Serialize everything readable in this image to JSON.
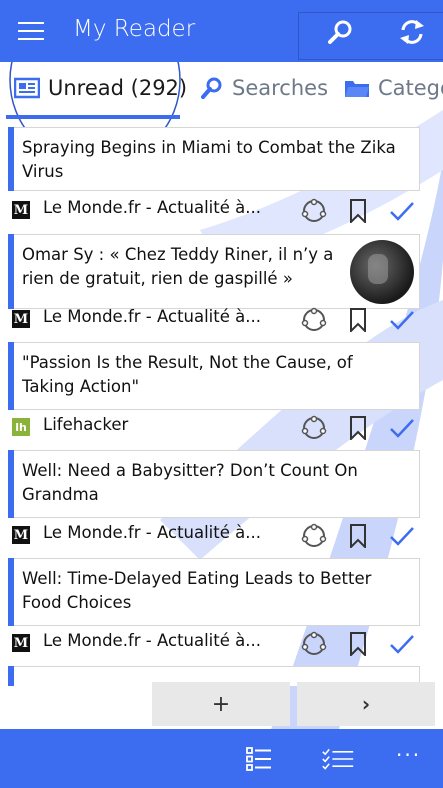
{
  "app": {
    "title": "My Reader",
    "accent": "#3c6cf0"
  },
  "header": {
    "menu_icon": "hamburger-icon",
    "search_icon": "search-icon",
    "refresh_icon": "refresh-icon"
  },
  "tabs": [
    {
      "label": "Unread (292)",
      "icon": "newspaper-icon",
      "active": true
    },
    {
      "label": "Searches",
      "icon": "search-icon",
      "active": false
    },
    {
      "label": "Catego",
      "icon": "folder-icon",
      "active": false
    }
  ],
  "articles": [
    {
      "title": "Spraying Begins in Miami to Combat the Zika Virus",
      "source": "Le Monde.fr - Actualité à...",
      "source_icon": "M",
      "has_thumb": false
    },
    {
      "title": "Omar Sy : « Chez Teddy Riner, il n’y a rien de gratuit, rien de gaspillé »",
      "source": "Le Monde.fr - Actualité à...",
      "source_icon": "M",
      "has_thumb": true
    },
    {
      "title": "\"Passion Is the Result, Not the Cause, of Taking Action\"",
      "source": "Lifehacker",
      "source_icon": "lh",
      "has_thumb": false
    },
    {
      "title": "Well: Need a Babysitter? Don’t Count On Grandma",
      "source": "Le Monde.fr - Actualité à...",
      "source_icon": "M",
      "has_thumb": false
    },
    {
      "title": "Well: Time-Delayed Eating Leads to Better Food Choices",
      "source": "Le Monde.fr - Actualité à...",
      "source_icon": "M",
      "has_thumb": false
    }
  ],
  "footer": {
    "add_label": "+",
    "next_label": "›"
  },
  "appbar": {
    "list_icon": "list-view-icon",
    "markall_icon": "mark-all-read-icon",
    "more_label": "···"
  }
}
